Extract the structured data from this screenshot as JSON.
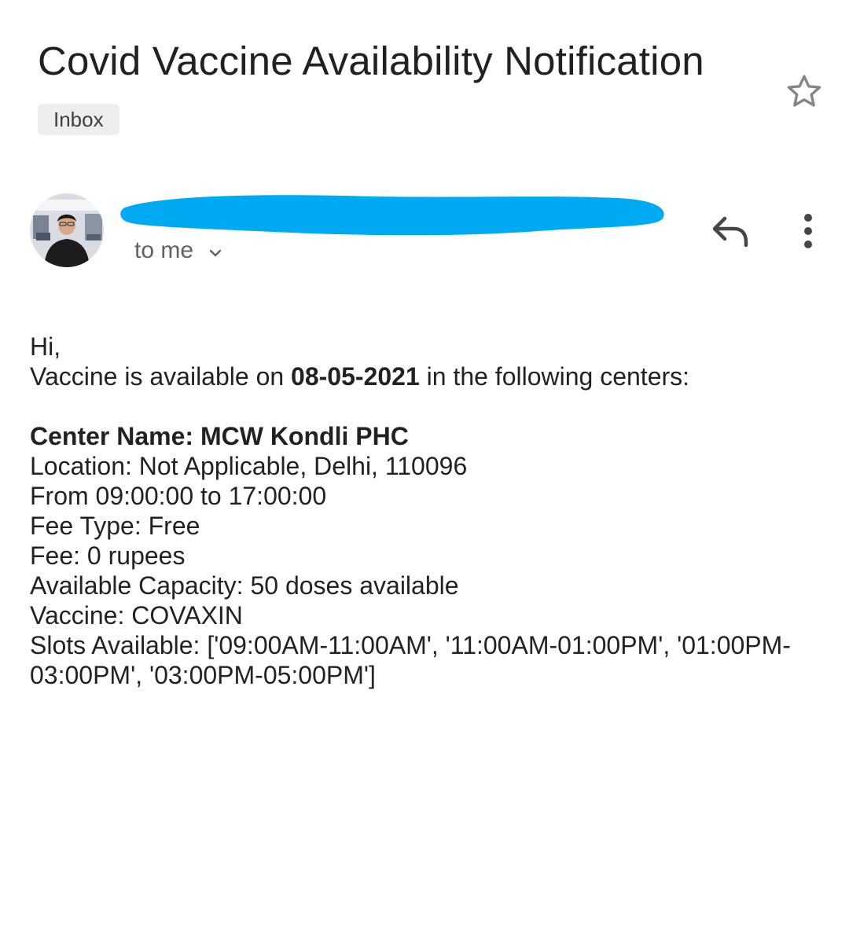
{
  "email": {
    "subject": "Covid Vaccine Availability Notification",
    "label": "Inbox",
    "recipient": "to me"
  },
  "body": {
    "greeting": "Hi,",
    "availability_prefix": "Vaccine is available on ",
    "date": "08-05-2021",
    "availability_suffix": " in the following centers:",
    "center_name": "Center Name: MCW Kondli PHC",
    "location": "Location: Not Applicable, Delhi, 110096",
    "hours": "From 09:00:00 to 17:00:00",
    "fee_type": "Fee Type: Free",
    "fee": "Fee: 0 rupees",
    "capacity": "Available Capacity: 50 doses available",
    "vaccine": "Vaccine: COVAXIN",
    "slots_line1": "Slots Available: ['09:00AM-11:00AM', '11:00AM-01:00PM', '01:00PM-",
    "slots_line2": "03:00PM', '03:00PM-05:00PM']"
  },
  "icons": {
    "star": "star-outline-icon",
    "reply": "reply-icon",
    "more": "more-vert-icon",
    "chevron": "chevron-down-icon"
  },
  "colors": {
    "redaction": "#00aaf2",
    "text_primary": "#202124",
    "text_secondary": "#5f6368",
    "chip_bg": "#eeeeee"
  }
}
